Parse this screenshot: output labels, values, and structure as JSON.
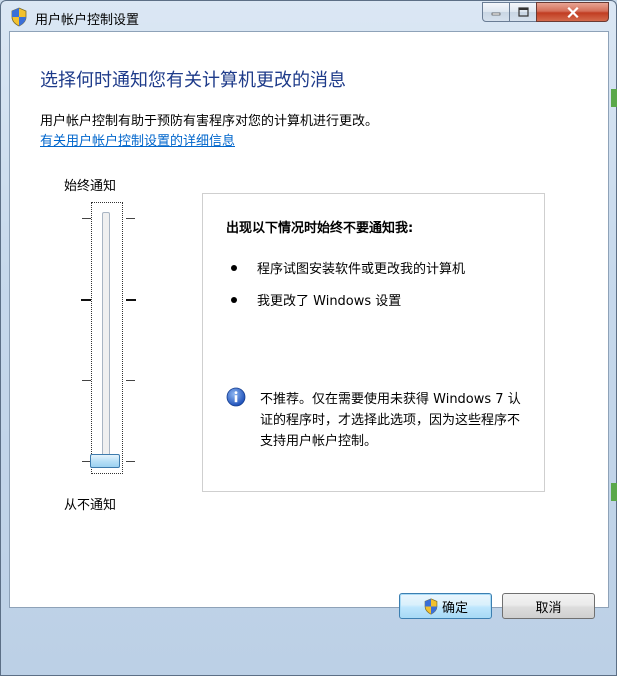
{
  "window": {
    "title": "用户帐户控制设置",
    "title_icon": "uac-shield-icon",
    "controls": [
      "minimize-icon",
      "maximize-icon",
      "close-icon"
    ]
  },
  "main": {
    "heading": "选择何时通知您有关计算机更改的消息",
    "description": "用户帐户控制有助于预防有害程序对您的计算机进行更改。",
    "help_link": "有关用户帐户控制设置的详细信息"
  },
  "slider": {
    "label_top": "始终通知",
    "label_bottom": "从不通知",
    "levels": 4,
    "selected_level": 1,
    "selected_description": "lowest level (never notify)"
  },
  "info_box": {
    "title": "出现以下情况时始终不要通知我:",
    "bullets": [
      "程序试图安装软件或更改我的计算机",
      "我更改了 Windows 设置"
    ],
    "note_icon": "info-icon",
    "note": "不推荐。仅在需要使用未获得 Windows 7 认证的程序时，才选择此选项，因为这些程序不支持用户帐户控制。"
  },
  "buttons": {
    "ok_label": "确定",
    "ok_icon": "uac-shield-icon",
    "cancel_label": "取消"
  },
  "colors": {
    "heading": "#1e3b8a",
    "link": "#0066cc",
    "thumb": "#b9e0f7",
    "close_button": "#c13d22"
  }
}
